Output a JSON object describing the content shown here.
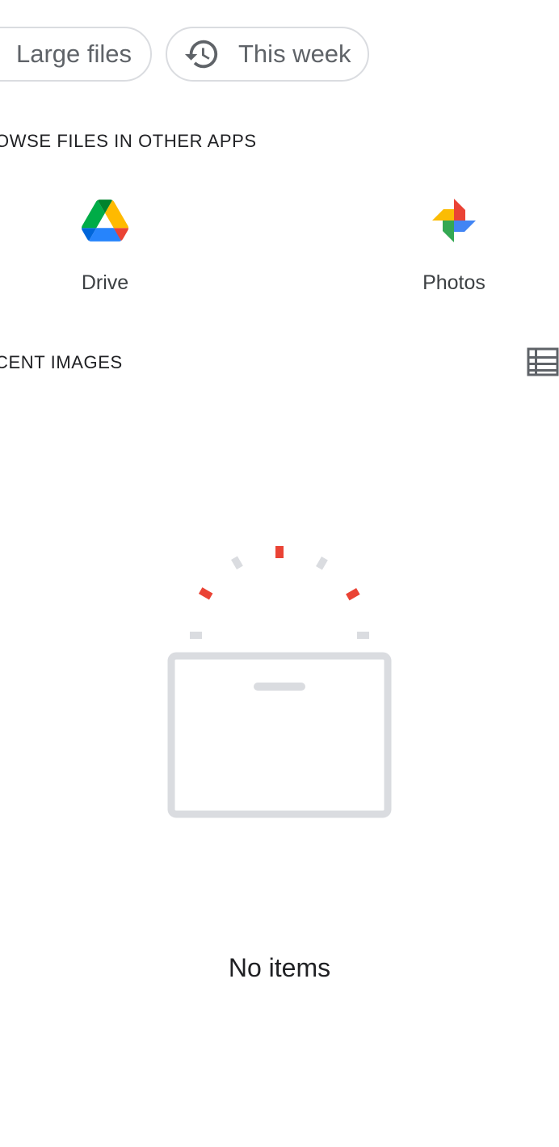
{
  "filters": {
    "large_files": "Large files",
    "this_week": "This week"
  },
  "sections": {
    "browse_apps": "OWSE FILES IN OTHER APPS",
    "recent_images": "CENT IMAGES"
  },
  "apps": [
    {
      "label": "Drive",
      "icon": "google-drive-icon"
    },
    {
      "label": "Photos",
      "icon": "google-photos-icon"
    }
  ],
  "empty_state": {
    "message": "No items"
  },
  "colors": {
    "accent_red": "#ea4335",
    "muted_gray": "#dadce0",
    "text": "#202124"
  }
}
